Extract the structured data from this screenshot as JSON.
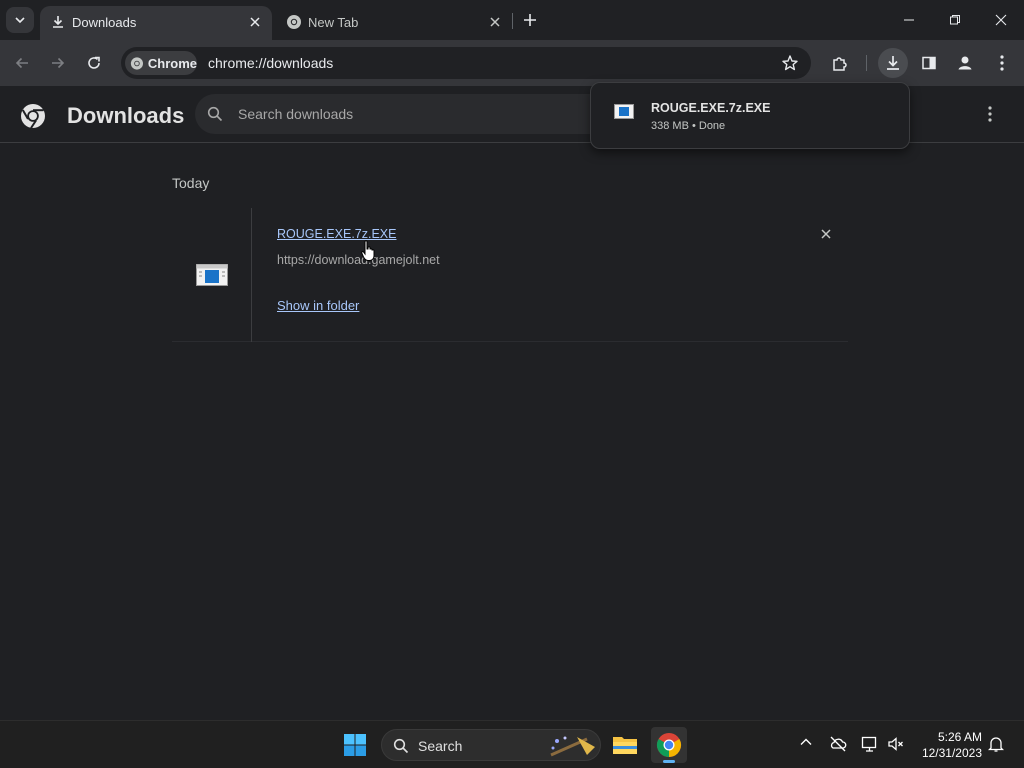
{
  "browser": {
    "tabs": [
      {
        "label": "Downloads",
        "icon": "download-icon",
        "active": true
      },
      {
        "label": "New Tab",
        "icon": "chrome-icon",
        "active": false
      }
    ],
    "omnibox": {
      "chip_label": "Chrome",
      "url": "chrome://downloads"
    }
  },
  "downloads_page": {
    "title": "Downloads",
    "search_placeholder": "Search downloads",
    "section_date": "Today",
    "items": [
      {
        "file_name": "ROUGE.EXE.7z.EXE",
        "source_url": "https://download.gamejolt.net",
        "action_label": "Show in folder"
      }
    ]
  },
  "download_bubble": {
    "file_name": "ROUGE.EXE.7z.EXE",
    "status": "338 MB • Done"
  },
  "taskbar": {
    "search_label": "Search",
    "time": "5:26 AM",
    "date": "12/31/2023"
  },
  "colors": {
    "accent_link": "#a8c7fa",
    "taskbar_indicator": "#5fb2f2"
  }
}
